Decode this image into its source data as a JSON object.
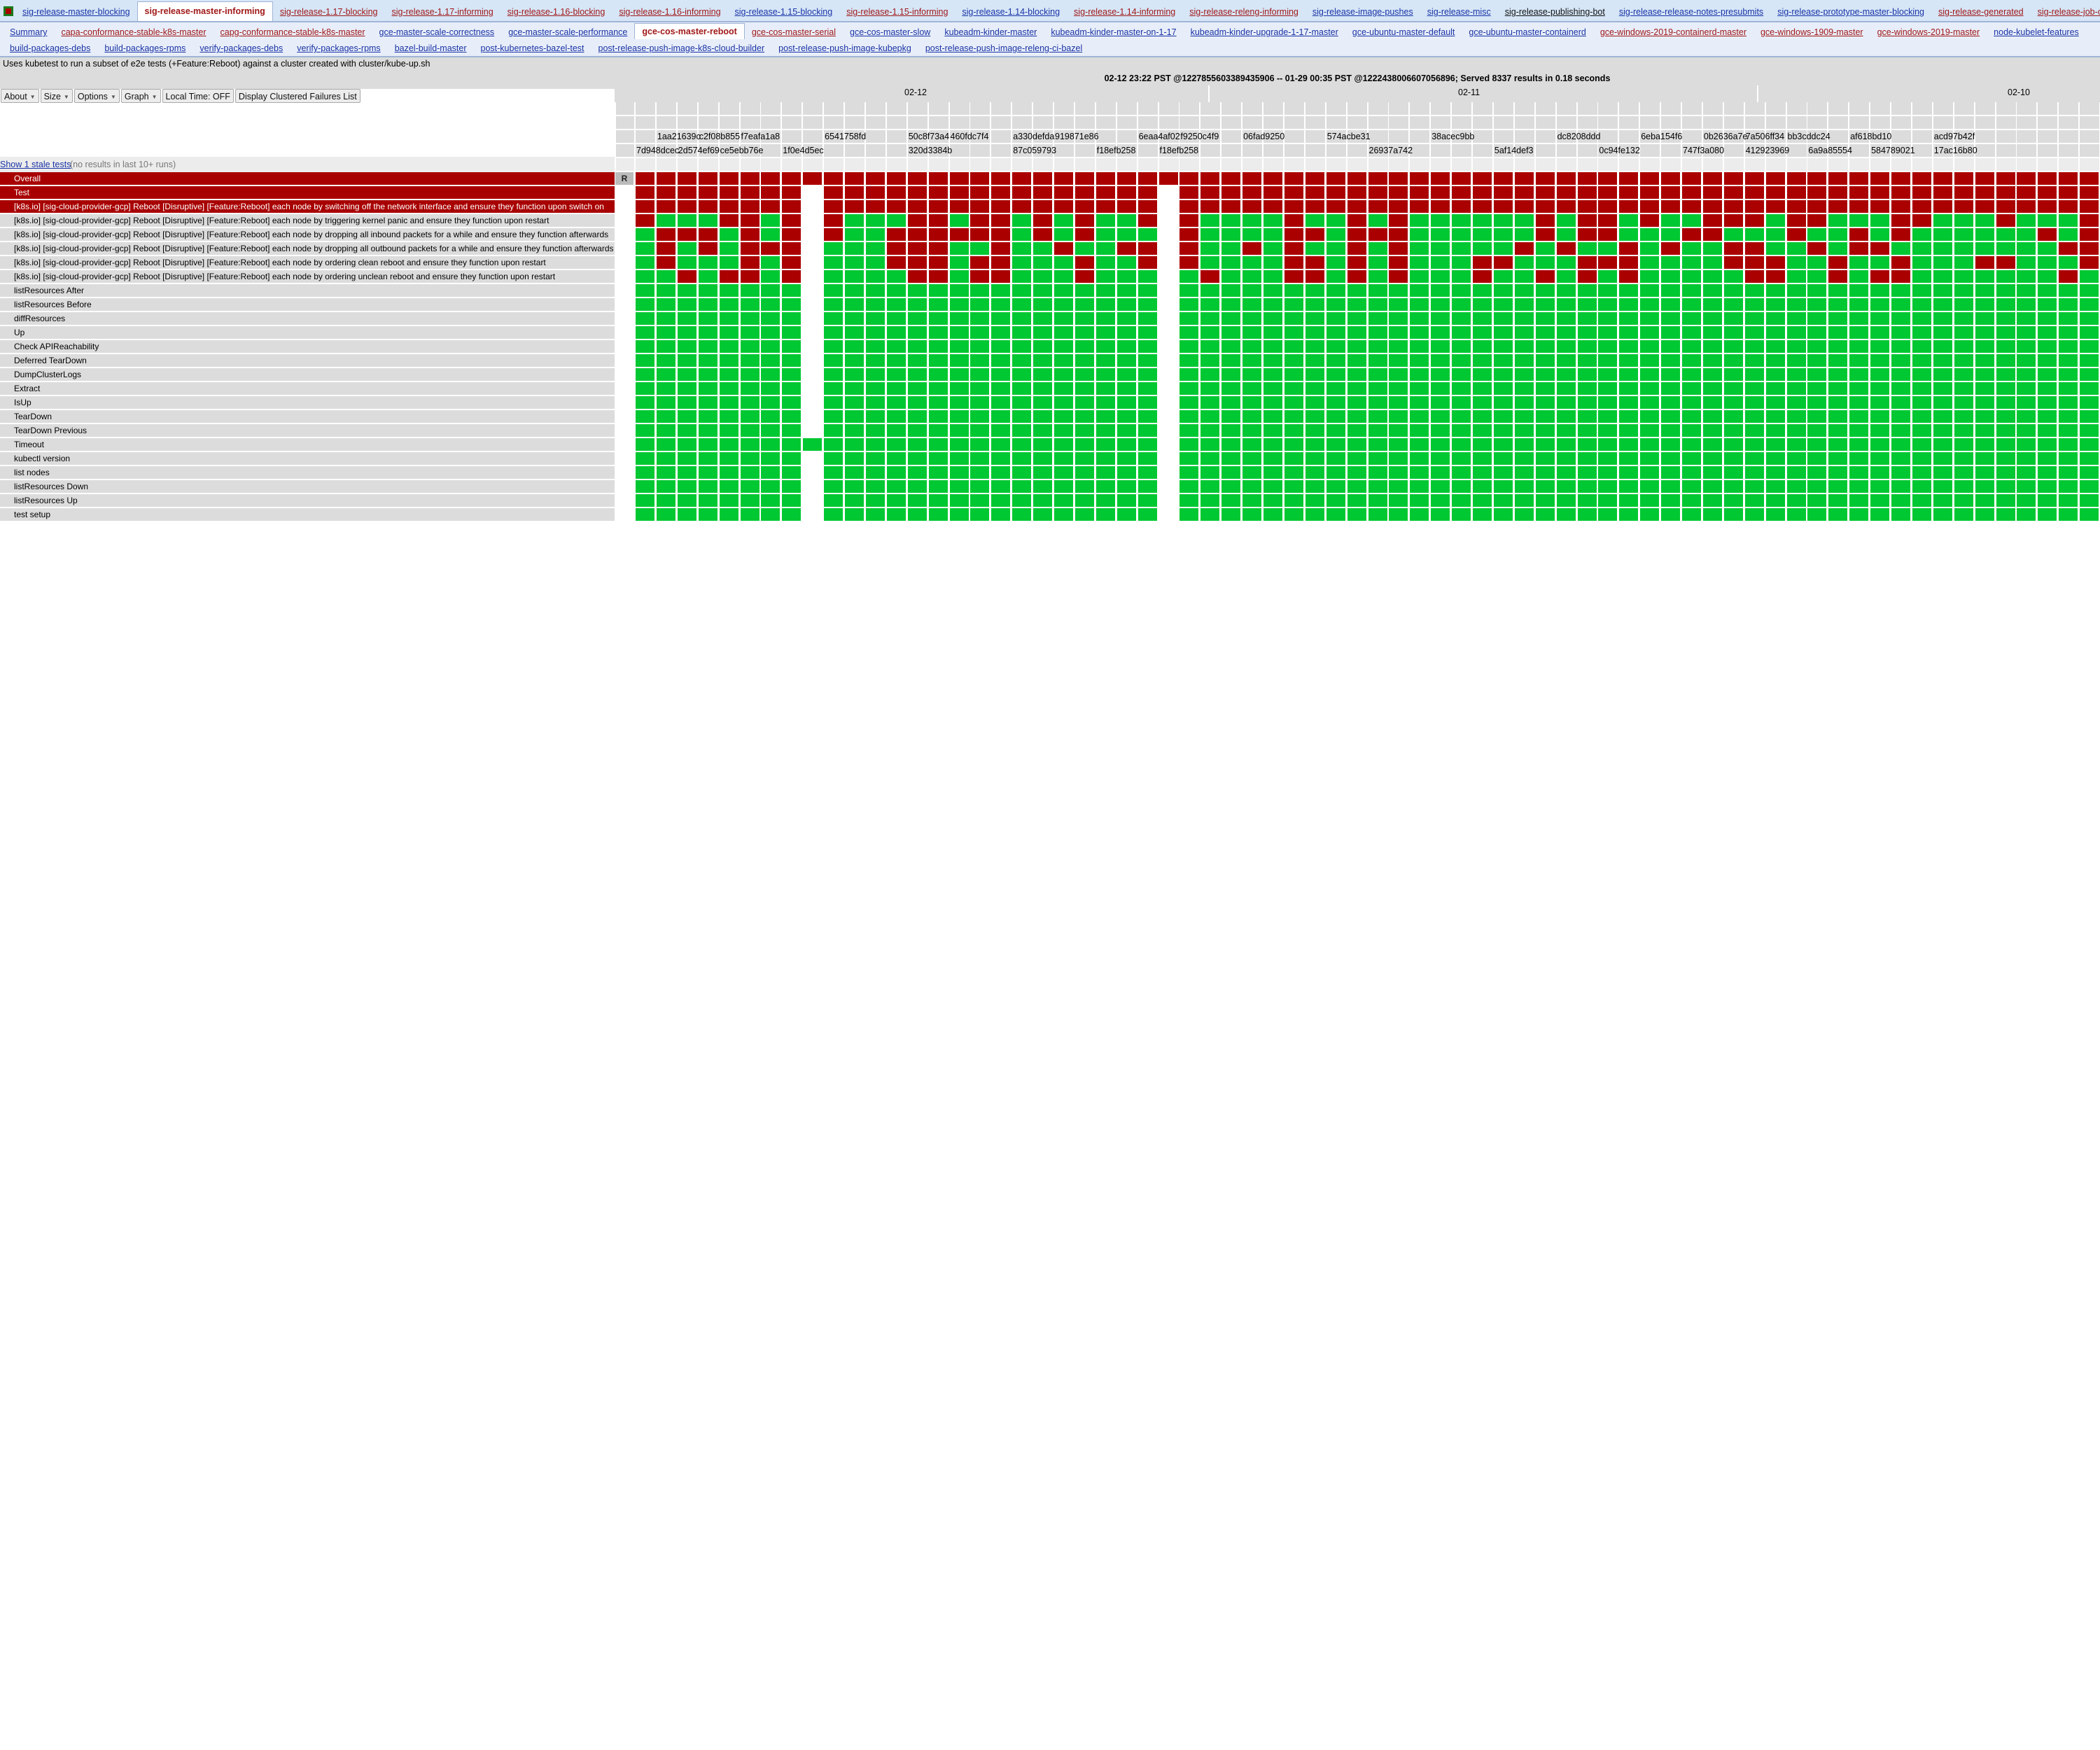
{
  "dashboard_tabs": [
    {
      "label": "sig-release-master-blocking",
      "color": "blue"
    },
    {
      "label": "sig-release-master-informing",
      "color": "red",
      "active": true
    },
    {
      "label": "sig-release-1.17-blocking",
      "color": "red"
    },
    {
      "label": "sig-release-1.17-informing",
      "color": "red"
    },
    {
      "label": "sig-release-1.16-blocking",
      "color": "red"
    },
    {
      "label": "sig-release-1.16-informing",
      "color": "red"
    },
    {
      "label": "sig-release-1.15-blocking",
      "color": "blue"
    },
    {
      "label": "sig-release-1.15-informing",
      "color": "red"
    },
    {
      "label": "sig-release-1.14-blocking",
      "color": "blue"
    },
    {
      "label": "sig-release-1.14-informing",
      "color": "red"
    },
    {
      "label": "sig-release-releng-informing",
      "color": "red"
    },
    {
      "label": "sig-release-image-pushes",
      "color": "blue"
    },
    {
      "label": "sig-release-misc",
      "color": "blue"
    },
    {
      "label": "sig-release-publishing-bot",
      "color": "dark"
    },
    {
      "label": "sig-release-release-notes-presubmits",
      "color": "blue"
    },
    {
      "label": "sig-release-prototype-master-blocking",
      "color": "blue"
    },
    {
      "label": "sig-release-generated",
      "color": "red"
    },
    {
      "label": "sig-release-job-config-errors",
      "color": "red"
    }
  ],
  "job_tabs_row1": [
    {
      "label": "Summary",
      "color": "blue"
    },
    {
      "label": "capa-conformance-stable-k8s-master",
      "color": "red"
    },
    {
      "label": "capg-conformance-stable-k8s-master",
      "color": "red"
    },
    {
      "label": "gce-master-scale-correctness",
      "color": "blue"
    },
    {
      "label": "gce-master-scale-performance",
      "color": "blue"
    },
    {
      "label": "gce-cos-master-reboot",
      "color": "red",
      "active": true
    },
    {
      "label": "gce-cos-master-serial",
      "color": "red"
    },
    {
      "label": "gce-cos-master-slow",
      "color": "blue"
    },
    {
      "label": "kubeadm-kinder-master",
      "color": "blue"
    },
    {
      "label": "kubeadm-kinder-master-on-1-17",
      "color": "blue"
    },
    {
      "label": "kubeadm-kinder-upgrade-1-17-master",
      "color": "blue"
    },
    {
      "label": "gce-ubuntu-master-default",
      "color": "blue"
    },
    {
      "label": "gce-ubuntu-master-containerd",
      "color": "blue"
    },
    {
      "label": "gce-windows-2019-containerd-master",
      "color": "red"
    },
    {
      "label": "gce-windows-1909-master",
      "color": "red"
    },
    {
      "label": "gce-windows-2019-master",
      "color": "red"
    },
    {
      "label": "node-kubelet-features",
      "color": "blue"
    }
  ],
  "job_tabs_row2": [
    {
      "label": "build-packages-debs",
      "color": "blue"
    },
    {
      "label": "build-packages-rpms",
      "color": "blue"
    },
    {
      "label": "verify-packages-debs",
      "color": "blue"
    },
    {
      "label": "verify-packages-rpms",
      "color": "blue"
    },
    {
      "label": "bazel-build-master",
      "color": "blue"
    },
    {
      "label": "post-kubernetes-bazel-test",
      "color": "blue"
    },
    {
      "label": "post-release-push-image-k8s-cloud-builder",
      "color": "blue"
    },
    {
      "label": "post-release-push-image-kubepkg",
      "color": "blue"
    },
    {
      "label": "post-release-push-image-releng-ci-bazel",
      "color": "blue"
    }
  ],
  "description": "Uses kubetest to run a subset of e2e tests (+Feature:Reboot) against a cluster created with cluster/kube-up.sh",
  "toolbar": {
    "about": "About",
    "size": "Size",
    "options": "Options",
    "graph": "Graph",
    "local_time": "Local Time: OFF",
    "clustered": "Display Clustered Failures List"
  },
  "stale": {
    "link": "Show 1 stale tests",
    "note": "(no results in last 10+ runs)"
  },
  "header_info": "02-12 23:22 PST @1227855603389435906 -- 01-29 00:35 PST @1222438006607056896; Served 8337 results in 0.18 seconds",
  "dates": [
    "02-12",
    "02-11",
    "02-10"
  ],
  "commits_row1": [
    {
      "col": 1,
      "text": "1aa21639c"
    },
    {
      "col": 3,
      "text": "c2f08b855"
    },
    {
      "col": 5,
      "text": "f7eafa1a8"
    },
    {
      "col": 9,
      "text": "6541758fd"
    },
    {
      "col": 13,
      "text": "50c8f73a4"
    },
    {
      "col": 15,
      "text": "460fdc7f4"
    },
    {
      "col": 18,
      "text": "a330defda"
    },
    {
      "col": 20,
      "text": "919871e86"
    },
    {
      "col": 24,
      "text": "6eaa4af02"
    },
    {
      "col": 26,
      "text": "f9250c4f9"
    },
    {
      "col": 29,
      "text": "06fad9250"
    },
    {
      "col": 33,
      "text": "574acbe31"
    },
    {
      "col": 38,
      "text": "38acec9bb"
    },
    {
      "col": 44,
      "text": "dc8208ddd"
    },
    {
      "col": 48,
      "text": "6eba154f6"
    },
    {
      "col": 51,
      "text": "0b2636a7e"
    },
    {
      "col": 53,
      "text": "7a506ff34"
    },
    {
      "col": 55,
      "text": "bb3cddc24"
    },
    {
      "col": 58,
      "text": "af618bd10"
    },
    {
      "col": 62,
      "text": "acd97b42f"
    }
  ],
  "commits_row2": [
    {
      "col": 0,
      "text": "7d948dcec"
    },
    {
      "col": 2,
      "text": "2d574ef69"
    },
    {
      "col": 4,
      "text": "ce5ebb76e"
    },
    {
      "col": 7,
      "text": "1f0e4d5ec"
    },
    {
      "col": 13,
      "text": "320d3384b"
    },
    {
      "col": 18,
      "text": "87c059793"
    },
    {
      "col": 22,
      "text": "f18efb258"
    },
    {
      "col": 25,
      "text": "f18efb258"
    },
    {
      "col": 35,
      "text": "26937a742"
    },
    {
      "col": 41,
      "text": "5af14def3"
    },
    {
      "col": 46,
      "text": "0c94fe132"
    },
    {
      "col": 50,
      "text": "747f3a080"
    },
    {
      "col": 53,
      "text": "412923969"
    },
    {
      "col": 56,
      "text": "6a9a85554"
    },
    {
      "col": 59,
      "text": "584789021"
    },
    {
      "col": 62,
      "text": "17ac16b80"
    }
  ],
  "overall_marker": "R",
  "status_colors": {
    "fail": "#aa0000",
    "pass": "#00c832",
    "none": "#ffffff"
  },
  "tests": [
    {
      "name": "Overall",
      "failing": true,
      "results": "FFFFFFFFFFFFFFFFFFFFFFFFFFFFFFFFFFFFFFFFFFFFFFFFFFFFFFFFFFFFFFFFFFFFFF"
    },
    {
      "name": "Test",
      "failing": true,
      "results": "FFFFFFFFNFFFFFFFFFFFFFFFFNFFFFFFFFFFFFFFFFFFFFFFFFFFFFFFFFFFFFFFFFFFFF"
    },
    {
      "name": "[k8s.io] [sig-cloud-provider-gcp] Reboot [Disruptive] [Feature:Reboot] each node by switching off the network interface and ensure they function upon switch on",
      "failing": true,
      "results": "FFFFFFFFNFFFFFFFFFFFFFFFFNFFFFFFFFFFFFFFFFFFFFFFFFFFFFFFFFFFFFFFFFFFFF"
    },
    {
      "name": "[k8s.io] [sig-cloud-provider-gcp] Reboot [Disruptive] [Feature:Reboot] each node by triggering kernel panic and ensure they function upon restart",
      "failing": false,
      "results": "FPPPFFPFNFPPPFFPFFPFPFPPFNFPPPPFPPFPFPPPPPPFPFFPFPPFFRPFFPPPFFPPPFPPPFF"
    },
    {
      "name": "[k8s.io] [sig-cloud-provider-gcp] Reboot [Disruptive] [Feature:Reboot] each node by dropping all inbound packets for a while and ensure they function afterwards",
      "failing": false,
      "results": "PFFFPFPFNFPPFFFFFFPFPFPPPNFPPPPFFPFFRPPPPPPFPFFPPPFFPPPFPPFPFPPPPPPFPF"
    },
    {
      "name": "[k8s.io] [sig-cloud-provider-gcp] Reboot [Disruptive] [Feature:Reboot] each node by dropping all outbound packets for a while and ensure they function afterwards",
      "failing": false,
      "results": "PFPFPFFFNPPPFFFPPFPPFPPRFNFPPFPFPPFPGPPPPPFPFPPFPFPPFRPPFPFFPPPPPPPPFF"
    },
    {
      "name": "[k8s.io] [sig-cloud-provider-gcp] Reboot [Disruptive] [Feature:Reboot] each node by ordering clean reboot and ensure they function upon restart",
      "failing": false,
      "results": "PFPPPFPFNPPPFFFPFFPPPFPPFNFPPPPFFPFPFPPPFFPPPFFFPPPPFFRPPFPPFPPPFFPPPFFF"
    },
    {
      "name": "[k8s.io] [sig-cloud-provider-gcp] Reboot [Disruptive] [Feature:Reboot] each node by ordering unclean reboot and ensure they function upon restart",
      "failing": false,
      "results": "PPFPFFPFNPPPPFFPFFPPPFPPPNPFPPPFFPFPFPPPFPPFPFPFPPPPPFRPPFPFFPPPPPPPFPF"
    },
    {
      "name": "listResources After",
      "failing": false,
      "results": "PPPPPPPPNPPPPPPPPPPPPPPPPNPPPPPPPPPPPPPPPPPPPPPPPPPPPPPPPPPPPPPPPPPPPP"
    },
    {
      "name": "listResources Before",
      "failing": false,
      "results": "PPPPPPPPNPPPPPPPPPPPPPPPPNPPPPPPPPPPPPPPPPPPPPPPPPPPPPPPPPPPPPPPPPPPPP"
    },
    {
      "name": "diffResources",
      "failing": false,
      "results": "PPPPPPPPNPPPPPPPPPPPPPPPPNPPPPPPPPPPPPPPPPPPPPPPPPPPPPPPPPPPPPPPPPPPPP"
    },
    {
      "name": "Up",
      "failing": false,
      "results": "PPPPPPPPNPPPPPPPPPPPPPPPPNPPPPPPPPPPPPPPPPPPPPPPPPPPPPPPPPPPPPPPPPPPPP"
    },
    {
      "name": "Check APIReachability",
      "failing": false,
      "results": "PPPPPPPPNPPPPPPPPPPPPPPPPNPPPPPPPPPPPPPPPPPPPPPPPPPPPPPPPPPPPPPPPPPPPP"
    },
    {
      "name": "Deferred TearDown",
      "failing": false,
      "results": "PPPPPPPPNPPPPPPPPPPPPPPPPNPPPPPPPPPPPPPPPPPPPPPPPPPPPPPPPPPPPPPPPPPPPP"
    },
    {
      "name": "DumpClusterLogs",
      "failing": false,
      "results": "PPPPPPPPNPPPPPPPPPPPPPPPPNPPPPPPPPPPPPPPPPPPPPPPPPPPPPPPPPPPPPPPPPPPPP"
    },
    {
      "name": "Extract",
      "failing": false,
      "results": "PPPPPPPPNPPPPPPPPPPPPPPPPNPPPPPPPPPPPPPPPPPPPPPPPPPPPPPPPPPPPPPPPPPPPP"
    },
    {
      "name": "IsUp",
      "failing": false,
      "results": "PPPPPPPPNPPPPPPPPPPPPPPPPNPPPPPPPPPPPPPPPPPPPPPPPPPPPPPPPPPPPPPPPPPPPP"
    },
    {
      "name": "TearDown",
      "failing": false,
      "results": "PPPPPPPPNPPPPPPPPPPPPPPPPNPPPPPPPPPPPPPPPPPPPPPPPPPPPPPPPPPPPPPPPPPPPP"
    },
    {
      "name": "TearDown Previous",
      "failing": false,
      "results": "PPPPPPPPNPPPPPPPPPPPPPPPPNPPPPPPPPPPPPPPPPPPPPPPPPPPPPPPPPPPPPPPPPPPPP"
    },
    {
      "name": "Timeout",
      "failing": false,
      "results": "PPPPPPPPPPPPPPPPPPPPPPPPPNPPPPPPPPPPPPPPPPPPPPPPPPPPPPPPPPPPPPPPPPPPPP"
    },
    {
      "name": "kubectl version",
      "failing": false,
      "results": "PPPPPPPPNPPPPPPPPPPPPPPPPNPPPPPPPPPPPPPPPPPPPPPPPPPPPPPPPPPPPPPPPPPPPP"
    },
    {
      "name": "list nodes",
      "failing": false,
      "results": "PPPPPPPPNPPPPPPPPPPPPPPPPNPPPPPPPPPPPPPPPPPPPPPPPPPPPPPPPPPPPPPPPPPPPP"
    },
    {
      "name": "listResources Down",
      "failing": false,
      "results": "PPPPPPPPNPPPPPPPPPPPPPPPPNPPPPPPPPPPPPPPPPPPPPPPPPPPPPPPPPPPPPPPPPPPPP"
    },
    {
      "name": "listResources Up",
      "failing": false,
      "results": "PPPPPPPPNPPPPPPPPPPPPPPPPNPPPPPPPPPPPPPPPPPPPPPPPPPPPPPPPPPPPPPPPPPPPP"
    },
    {
      "name": "test setup",
      "failing": false,
      "results": "PPPPPPPPNPPPPPPPPPPPPPPPPNPPPPPPPPPPPPPPPPPPPPPPPPPPPPPPPPPPPPPPPPPPPP"
    }
  ]
}
